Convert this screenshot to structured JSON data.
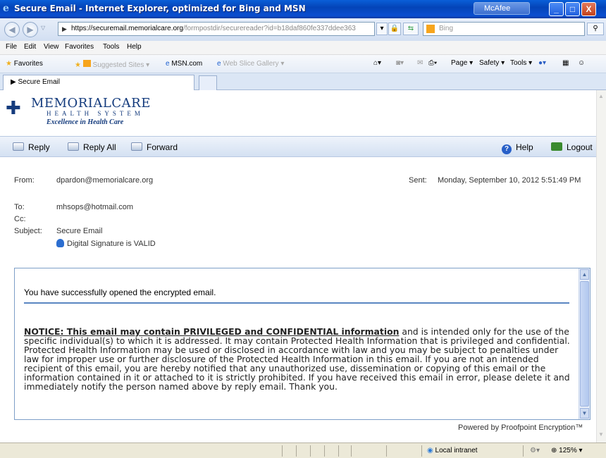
{
  "window": {
    "title": "Secure Email - Internet Explorer, optimized for Bing and MSN",
    "mcafee": "McAfee",
    "minimize": "_",
    "maximize": "□",
    "close": "X"
  },
  "address": {
    "url_main": "https://securemail.memorialcare.org",
    "url_rest": "/formpostdir/securereader?id=b18daf860fe337ddee363",
    "search_placeholder": "Bing"
  },
  "menu": [
    "File",
    "Edit",
    "View",
    "Favorites",
    "Tools",
    "Help"
  ],
  "favorites": {
    "label": "Favorites",
    "items": [
      "Suggested Sites ▾",
      "MSN.com",
      "Web Slice Gallery ▾"
    ]
  },
  "commandbar": [
    "Page ▾",
    "Safety ▾",
    "Tools ▾"
  ],
  "tab": {
    "label": "Secure Email"
  },
  "logo": {
    "name": "MEMORIALCARE",
    "sub": "HEALTH SYSTEM",
    "tagline": "Excellence in Health Care"
  },
  "toolbar": {
    "reply": "Reply",
    "reply_all": "Reply All",
    "forward": "Forward",
    "help": "Help",
    "logout": "Logout"
  },
  "message": {
    "from_label": "From:",
    "from": "dpardon@memorialcare.org",
    "sent_label": "Sent:",
    "sent": "Monday, September 10, 2012 5:51:49 PM",
    "to_label": "To:",
    "to": "mhsops@hotmail.com",
    "cc_label": "Cc:",
    "subject_label": "Subject:",
    "subject": "Secure Email",
    "signature": "Digital Signature is VALID",
    "opened_text": "You have successfully opened the encrypted email.",
    "notice_head": "NOTICE: This email may contain PRIVILEGED and CONFIDENTIAL information",
    "notice_body": " and is intended only for the use of the specific individual(s) to which it is addressed. It may contain Protected Health Information that is privileged and confidential. Protected Health Information may be used or disclosed in accordance with law and you may be subject to penalties under law for improper use or further disclosure of the Protected Health Information in this email. If you are not an intended recipient of this email, you are hereby notified that any unauthorized use, dissemination or copying of this email or the information contained in it or attached to it is strictly prohibited. If you have received this email in error, please delete it and immediately notify the person named above by reply email. Thank you.",
    "powered_by": "Powered by Proofpoint Encryption™"
  },
  "status": {
    "zone": "Local intranet",
    "zoom": "125%"
  }
}
